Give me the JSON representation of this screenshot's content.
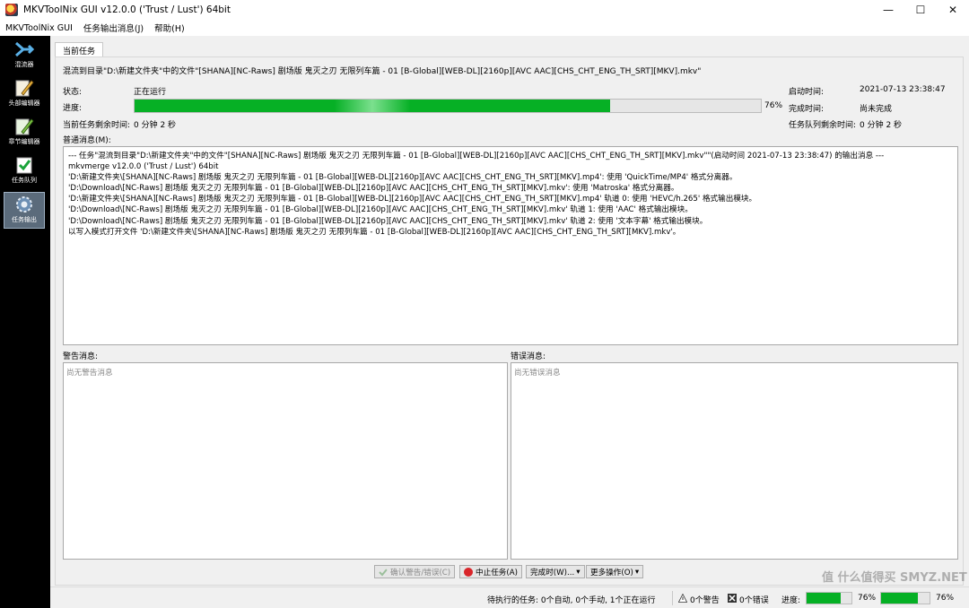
{
  "window": {
    "title": "MKVToolNix GUI v12.0.0 ('Trust / Lust') 64bit",
    "minimize": "—",
    "maximize": "☐",
    "close": "✕"
  },
  "menu": [
    "MKVToolNix GUI",
    "任务输出消息(J)",
    "帮助(H)"
  ],
  "sidebar": [
    {
      "label": "混流器",
      "icon": "merge-arrow-icon"
    },
    {
      "label": "头部编辑器",
      "icon": "header-editor-pencil-icon"
    },
    {
      "label": "章节编辑器",
      "icon": "chapter-editor-pencil-icon"
    },
    {
      "label": "任务队列",
      "icon": "job-queue-check-icon"
    },
    {
      "label": "任务输出",
      "icon": "job-output-gear-icon",
      "active": true
    }
  ],
  "tab": {
    "label": "当前任务"
  },
  "job": {
    "description": "混流到目录\"D:\\新建文件夹\"中的文件\"[SHANA][NC-Raws] 剧场版 鬼灭之刃 无限列车篇 - 01 [B-Global][WEB-DL][2160p][AVC AAC][CHS_CHT_ENG_TH_SRT][MKV].mkv\"",
    "status_label": "状态:",
    "status_value": "正在运行",
    "progress_label": "进度:",
    "progress_percent": 76,
    "progress_text": "76%",
    "remaining_label": "当前任务剩余时间:",
    "remaining_value": "0 分钟 2 秒",
    "start_label": "启动时间:",
    "start_value": "2021-07-13 23:38:47",
    "finish_label": "完成时间:",
    "finish_value": "尚未完成",
    "queue_remaining_label": "任务队列剩余时间:",
    "queue_remaining_value": "0 分钟 2 秒"
  },
  "messages": {
    "general_label": "普通消息(M):",
    "general_lines": [
      "--- 任务\"混流到目录\"D:\\新建文件夹\"中的文件\"[SHANA][NC-Raws] 剧场版 鬼灭之刃 无限列车篇 - 01 [B-Global][WEB-DL][2160p][AVC AAC][CHS_CHT_ENG_TH_SRT][MKV].mkv\"\"(启动时间 2021-07-13 23:38:47) 的输出消息 ---",
      "mkvmerge v12.0.0 ('Trust / Lust') 64bit",
      "'D:\\新建文件夹\\[SHANA][NC-Raws] 剧场版 鬼灭之刃 无限列车篇 - 01 [B-Global][WEB-DL][2160p][AVC AAC][CHS_CHT_ENG_TH_SRT][MKV].mp4': 使用 'QuickTime/MP4' 格式分离器。",
      "'D:\\Download\\[NC-Raws] 剧场版 鬼灭之刃 无限列车篇 - 01 [B-Global][WEB-DL][2160p][AVC AAC][CHS_CHT_ENG_TH_SRT][MKV].mkv': 使用 'Matroska' 格式分离器。",
      "'D:\\新建文件夹\\[SHANA][NC-Raws] 剧场版 鬼灭之刃 无限列车篇 - 01 [B-Global][WEB-DL][2160p][AVC AAC][CHS_CHT_ENG_TH_SRT][MKV].mp4' 轨道 0: 使用 'HEVC/h.265' 格式输出模块。",
      "'D:\\Download\\[NC-Raws] 剧场版 鬼灭之刃 无限列车篇 - 01 [B-Global][WEB-DL][2160p][AVC AAC][CHS_CHT_ENG_TH_SRT][MKV].mkv' 轨道 1: 使用 'AAC' 格式输出模块。",
      "'D:\\Download\\[NC-Raws] 剧场版 鬼灭之刃 无限列车篇 - 01 [B-Global][WEB-DL][2160p][AVC AAC][CHS_CHT_ENG_TH_SRT][MKV].mkv' 轨道 2: 使用 '文本字幕' 格式输出模块。",
      "以写入模式打开文件 'D:\\新建文件夹\\[SHANA][NC-Raws] 剧场版 鬼灭之刃 无限列车篇 - 01 [B-Global][WEB-DL][2160p][AVC AAC][CHS_CHT_ENG_TH_SRT][MKV].mkv'。"
    ],
    "warnings_label": "警告消息:",
    "warnings_placeholder": "尚无警告消息",
    "errors_label": "错误消息:",
    "errors_placeholder": "尚无错误消息"
  },
  "buttons": {
    "acknowledge": "确认警告/错误(C)",
    "abort": "中止任务(A)",
    "when_finished": "完成时(W)...",
    "more_actions": "更多操作(O)"
  },
  "statusbar": {
    "pending": "待执行的任务: 0个自动, 0个手动, 1个正在运行",
    "warnings": "0个警告",
    "errors": "0个错误",
    "progress_label": "进度:",
    "progress_text": "76%",
    "progress_text_2": "76%",
    "progress_percent": 76
  },
  "watermark": "值 什么值得买 SMYZ.NET",
  "colors": {
    "progress_green": "#06b025",
    "sidebar_bg": "#000000",
    "abort_icon": "#d9252a"
  }
}
